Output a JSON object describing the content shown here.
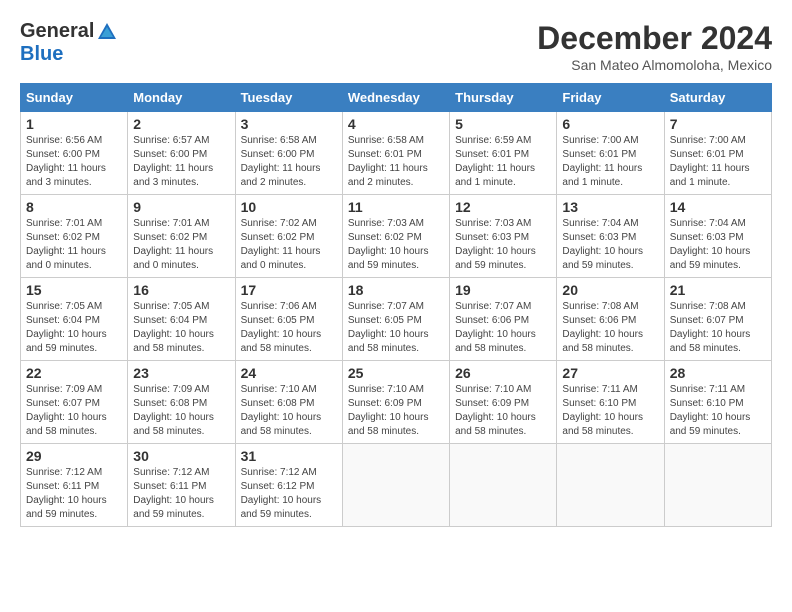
{
  "logo": {
    "general": "General",
    "blue": "Blue"
  },
  "title": "December 2024",
  "subtitle": "San Mateo Almomoloha, Mexico",
  "days_of_week": [
    "Sunday",
    "Monday",
    "Tuesday",
    "Wednesday",
    "Thursday",
    "Friday",
    "Saturday"
  ],
  "weeks": [
    [
      {
        "num": "1",
        "info": "Sunrise: 6:56 AM\nSunset: 6:00 PM\nDaylight: 11 hours\nand 3 minutes."
      },
      {
        "num": "2",
        "info": "Sunrise: 6:57 AM\nSunset: 6:00 PM\nDaylight: 11 hours\nand 3 minutes."
      },
      {
        "num": "3",
        "info": "Sunrise: 6:58 AM\nSunset: 6:00 PM\nDaylight: 11 hours\nand 2 minutes."
      },
      {
        "num": "4",
        "info": "Sunrise: 6:58 AM\nSunset: 6:01 PM\nDaylight: 11 hours\nand 2 minutes."
      },
      {
        "num": "5",
        "info": "Sunrise: 6:59 AM\nSunset: 6:01 PM\nDaylight: 11 hours\nand 1 minute."
      },
      {
        "num": "6",
        "info": "Sunrise: 7:00 AM\nSunset: 6:01 PM\nDaylight: 11 hours\nand 1 minute."
      },
      {
        "num": "7",
        "info": "Sunrise: 7:00 AM\nSunset: 6:01 PM\nDaylight: 11 hours\nand 1 minute."
      }
    ],
    [
      {
        "num": "8",
        "info": "Sunrise: 7:01 AM\nSunset: 6:02 PM\nDaylight: 11 hours\nand 0 minutes."
      },
      {
        "num": "9",
        "info": "Sunrise: 7:01 AM\nSunset: 6:02 PM\nDaylight: 11 hours\nand 0 minutes."
      },
      {
        "num": "10",
        "info": "Sunrise: 7:02 AM\nSunset: 6:02 PM\nDaylight: 11 hours\nand 0 minutes."
      },
      {
        "num": "11",
        "info": "Sunrise: 7:03 AM\nSunset: 6:02 PM\nDaylight: 10 hours\nand 59 minutes."
      },
      {
        "num": "12",
        "info": "Sunrise: 7:03 AM\nSunset: 6:03 PM\nDaylight: 10 hours\nand 59 minutes."
      },
      {
        "num": "13",
        "info": "Sunrise: 7:04 AM\nSunset: 6:03 PM\nDaylight: 10 hours\nand 59 minutes."
      },
      {
        "num": "14",
        "info": "Sunrise: 7:04 AM\nSunset: 6:03 PM\nDaylight: 10 hours\nand 59 minutes."
      }
    ],
    [
      {
        "num": "15",
        "info": "Sunrise: 7:05 AM\nSunset: 6:04 PM\nDaylight: 10 hours\nand 59 minutes."
      },
      {
        "num": "16",
        "info": "Sunrise: 7:05 AM\nSunset: 6:04 PM\nDaylight: 10 hours\nand 58 minutes."
      },
      {
        "num": "17",
        "info": "Sunrise: 7:06 AM\nSunset: 6:05 PM\nDaylight: 10 hours\nand 58 minutes."
      },
      {
        "num": "18",
        "info": "Sunrise: 7:07 AM\nSunset: 6:05 PM\nDaylight: 10 hours\nand 58 minutes."
      },
      {
        "num": "19",
        "info": "Sunrise: 7:07 AM\nSunset: 6:06 PM\nDaylight: 10 hours\nand 58 minutes."
      },
      {
        "num": "20",
        "info": "Sunrise: 7:08 AM\nSunset: 6:06 PM\nDaylight: 10 hours\nand 58 minutes."
      },
      {
        "num": "21",
        "info": "Sunrise: 7:08 AM\nSunset: 6:07 PM\nDaylight: 10 hours\nand 58 minutes."
      }
    ],
    [
      {
        "num": "22",
        "info": "Sunrise: 7:09 AM\nSunset: 6:07 PM\nDaylight: 10 hours\nand 58 minutes."
      },
      {
        "num": "23",
        "info": "Sunrise: 7:09 AM\nSunset: 6:08 PM\nDaylight: 10 hours\nand 58 minutes."
      },
      {
        "num": "24",
        "info": "Sunrise: 7:10 AM\nSunset: 6:08 PM\nDaylight: 10 hours\nand 58 minutes."
      },
      {
        "num": "25",
        "info": "Sunrise: 7:10 AM\nSunset: 6:09 PM\nDaylight: 10 hours\nand 58 minutes."
      },
      {
        "num": "26",
        "info": "Sunrise: 7:10 AM\nSunset: 6:09 PM\nDaylight: 10 hours\nand 58 minutes."
      },
      {
        "num": "27",
        "info": "Sunrise: 7:11 AM\nSunset: 6:10 PM\nDaylight: 10 hours\nand 58 minutes."
      },
      {
        "num": "28",
        "info": "Sunrise: 7:11 AM\nSunset: 6:10 PM\nDaylight: 10 hours\nand 59 minutes."
      }
    ],
    [
      {
        "num": "29",
        "info": "Sunrise: 7:12 AM\nSunset: 6:11 PM\nDaylight: 10 hours\nand 59 minutes."
      },
      {
        "num": "30",
        "info": "Sunrise: 7:12 AM\nSunset: 6:11 PM\nDaylight: 10 hours\nand 59 minutes."
      },
      {
        "num": "31",
        "info": "Sunrise: 7:12 AM\nSunset: 6:12 PM\nDaylight: 10 hours\nand 59 minutes."
      },
      null,
      null,
      null,
      null
    ]
  ]
}
